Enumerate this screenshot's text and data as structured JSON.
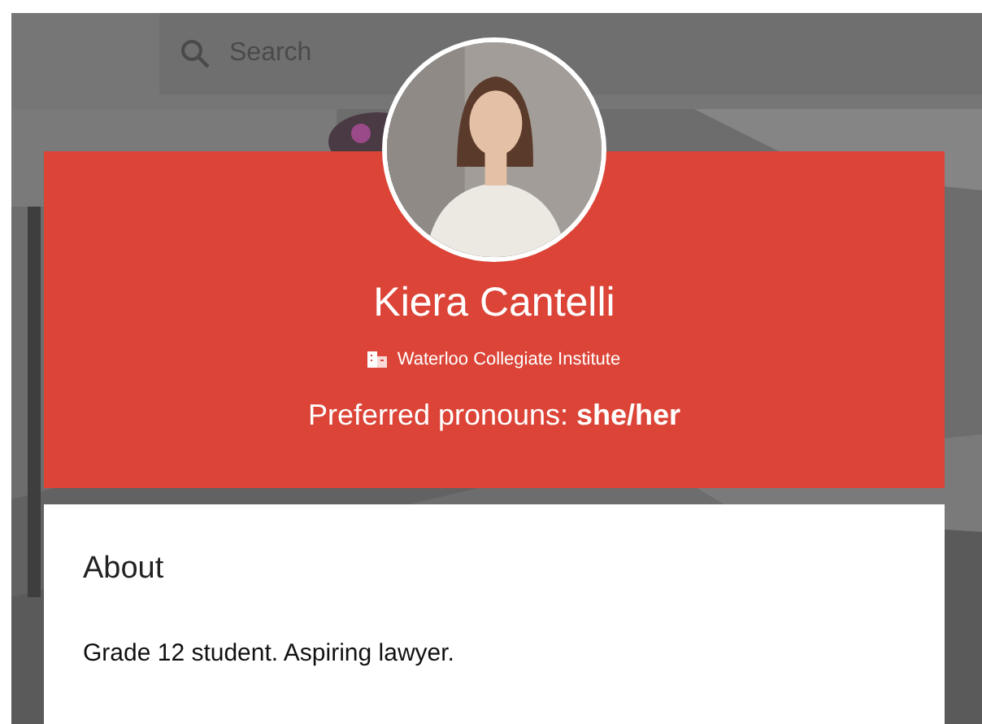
{
  "search": {
    "placeholder": "Search"
  },
  "profile": {
    "name": "Kiera Cantelli",
    "school": "Waterloo Collegiate Institute",
    "pronouns": "Preferred pronouns: **she/her**"
  },
  "about": {
    "title": "About",
    "text": "Grade 12 student. Aspiring lawyer."
  }
}
